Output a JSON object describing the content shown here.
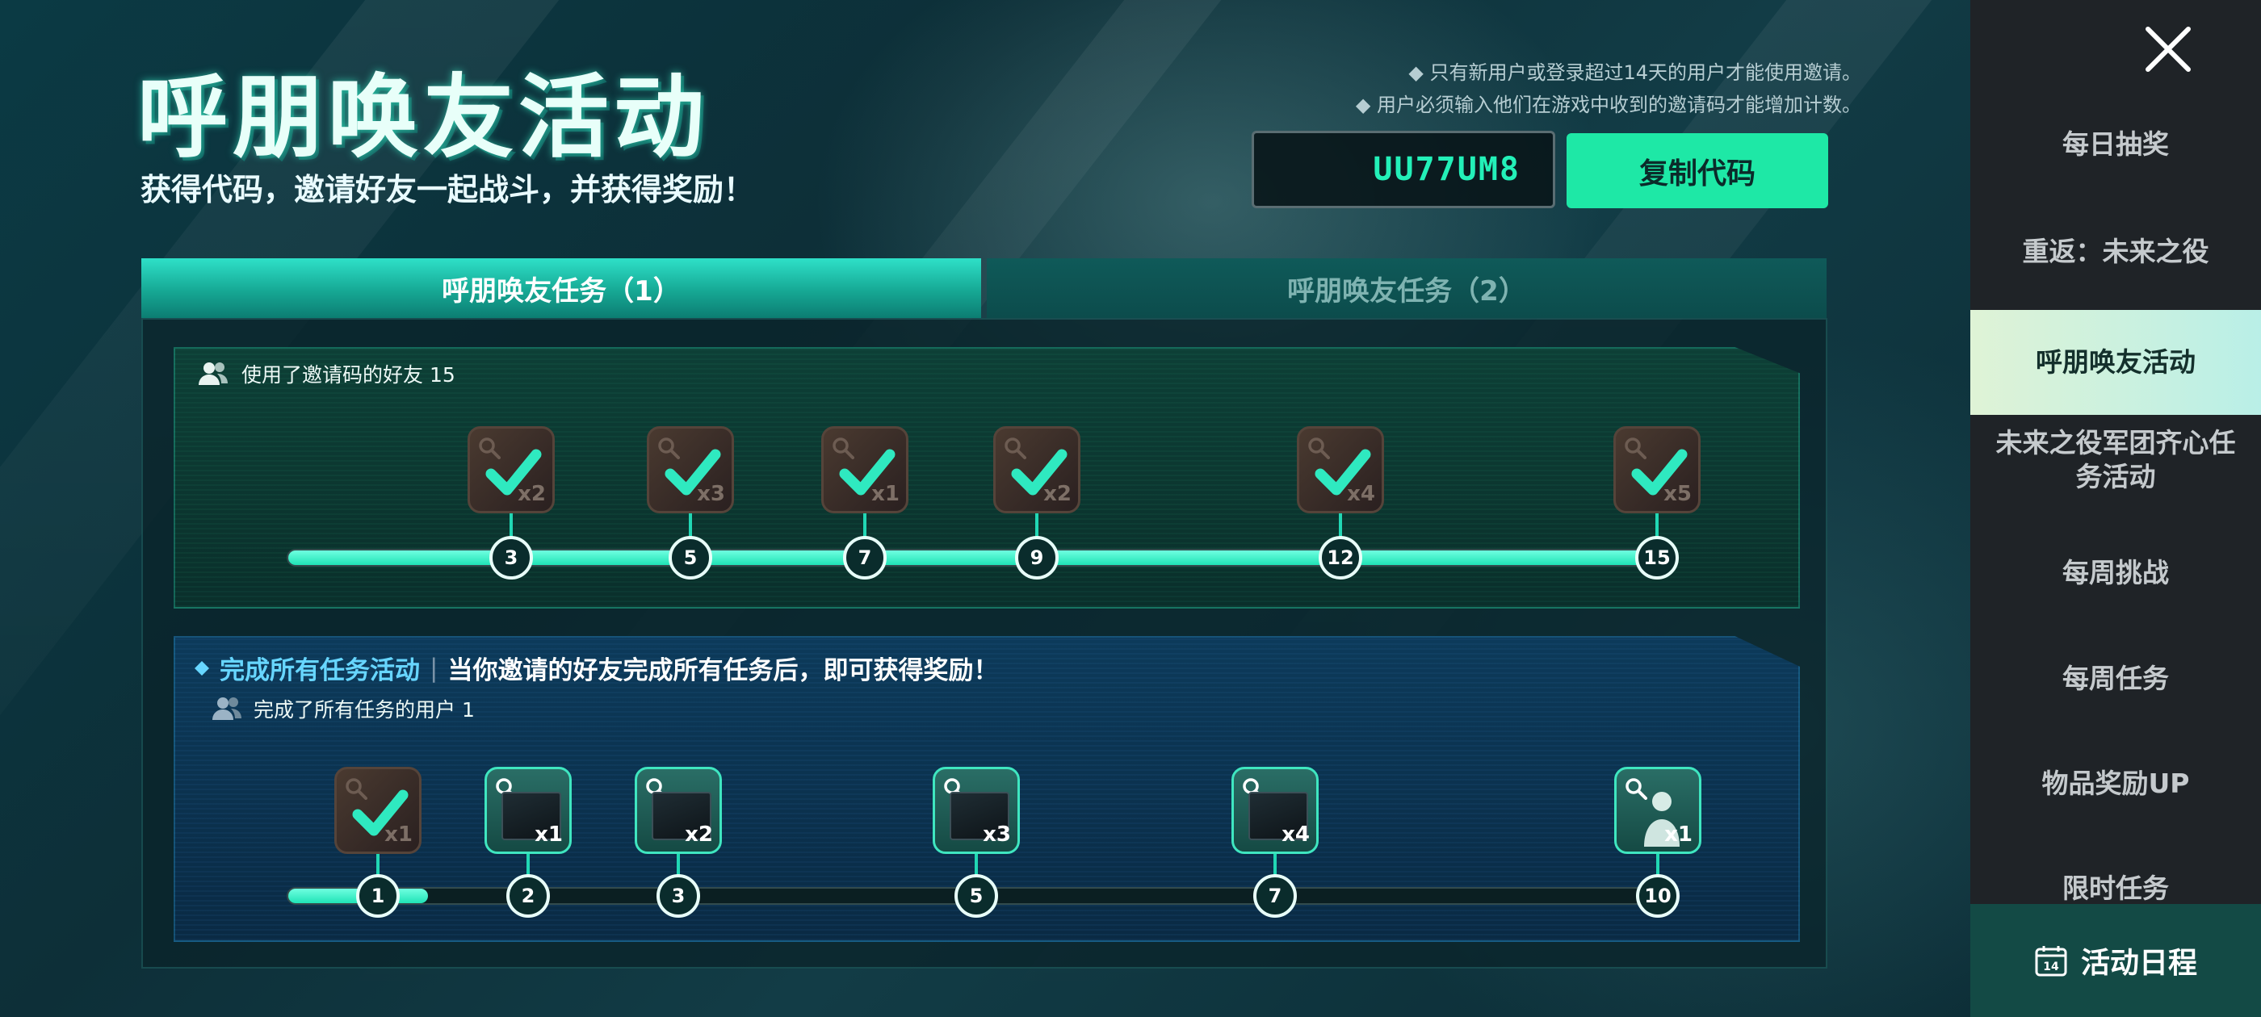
{
  "header": {
    "title": "呼朋唤友活动",
    "subtitle": "获得代码，邀请好友一起战斗，并获得奖励！",
    "notes": [
      "◆ 只有新用户或登录超过14天的用户才能使用邀请。",
      "◆ 用户必须输入他们在游戏中收到的邀请码才能增加计数。"
    ],
    "invite_code": "UU77UM8",
    "copy_label": "复制代码"
  },
  "tabs": [
    {
      "label": "呼朋唤友任务（1）",
      "active": true
    },
    {
      "label": "呼朋唤友任务（2）",
      "active": false
    }
  ],
  "section1": {
    "header": "使用了邀请码的好友 15",
    "progress_fraction": 1.0,
    "milestones": [
      {
        "value": "3",
        "qty": "x2",
        "claimed": true
      },
      {
        "value": "5",
        "qty": "x3",
        "claimed": true
      },
      {
        "value": "7",
        "qty": "x1",
        "claimed": true
      },
      {
        "value": "9",
        "qty": "x2",
        "claimed": true
      },
      {
        "value": "12",
        "qty": "x4",
        "claimed": true
      },
      {
        "value": "15",
        "qty": "x5",
        "claimed": true
      }
    ]
  },
  "section2": {
    "title": "完成所有任务活动",
    "separator": "|",
    "description": "当你邀请的好友完成所有任务后，即可获得奖励！",
    "subheader": "完成了所有任务的用户 1",
    "progress_value": 1,
    "milestones": [
      {
        "value": "1",
        "qty": "x1",
        "claimed": true,
        "kind": "check"
      },
      {
        "value": "2",
        "qty": "x1",
        "claimed": false,
        "kind": "item"
      },
      {
        "value": "3",
        "qty": "x2",
        "claimed": false,
        "kind": "item"
      },
      {
        "value": "5",
        "qty": "x3",
        "claimed": false,
        "kind": "item"
      },
      {
        "value": "7",
        "qty": "x4",
        "claimed": false,
        "kind": "item"
      },
      {
        "value": "10",
        "qty": "x1",
        "claimed": false,
        "kind": "person"
      }
    ]
  },
  "sidebar": {
    "items": [
      {
        "label": "每日抽奖"
      },
      {
        "label": "重返：未来之役"
      },
      {
        "label": "呼朋唤友活动",
        "active": true
      },
      {
        "label": "未来之役军团齐心任务活动"
      },
      {
        "label": "每周挑战"
      },
      {
        "label": "每周任务"
      },
      {
        "label": "物品奖励UP"
      },
      {
        "label": "限时任务"
      }
    ],
    "schedule_label": "活动日程",
    "schedule_icon_text": "14"
  },
  "colors": {
    "accent": "#1ee8a6",
    "code_text": "#23f0b8",
    "sidebar_bg": "#1f2327"
  }
}
